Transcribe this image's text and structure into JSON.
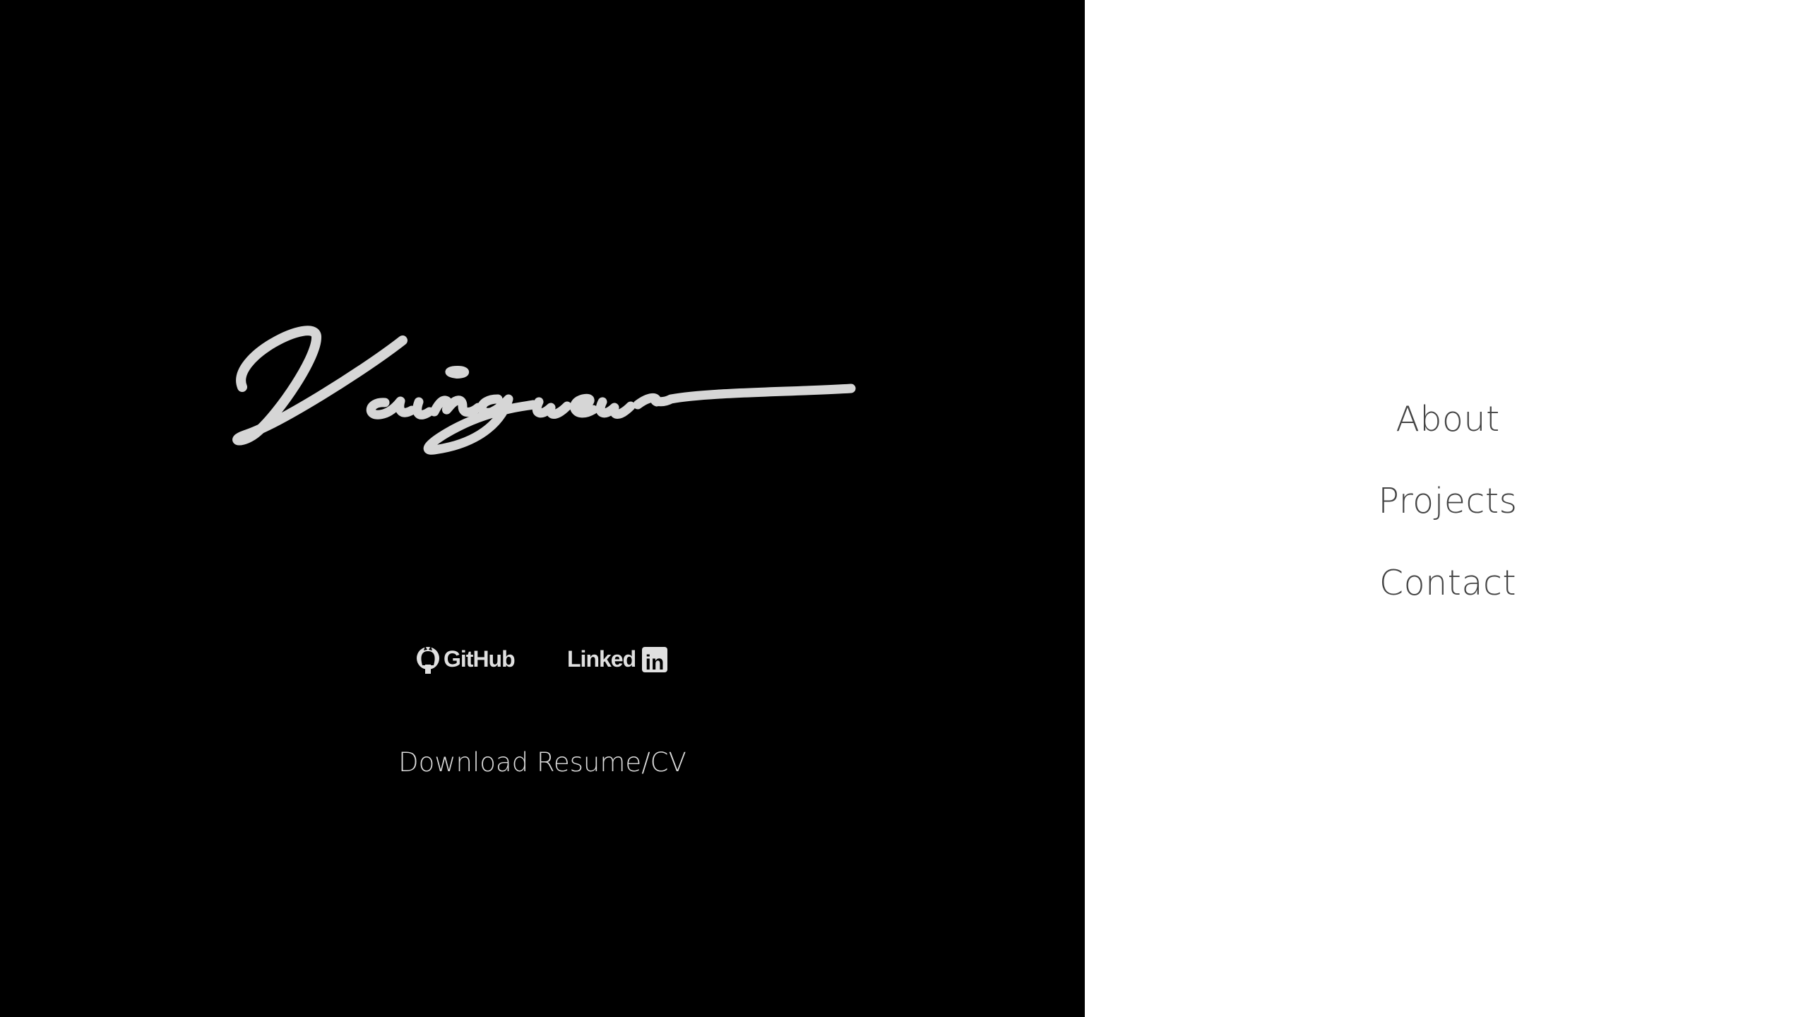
{
  "brand": {
    "signature_text": "Vainqueur",
    "signature_color": "#d6d6d6"
  },
  "social": {
    "github": {
      "label": "GitHub",
      "icon": "github-icon"
    },
    "linkedin": {
      "label": "Linked",
      "badge": "in",
      "icon": "linkedin-icon"
    }
  },
  "resume": {
    "label": "Download Resume/CV"
  },
  "nav": {
    "items": [
      {
        "label": "About"
      },
      {
        "label": "Projects"
      },
      {
        "label": "Contact"
      }
    ]
  },
  "colors": {
    "left_background": "#000000",
    "right_background": "#ffffff",
    "nav_text": "#444444",
    "light_text": "#dcdcdc"
  }
}
